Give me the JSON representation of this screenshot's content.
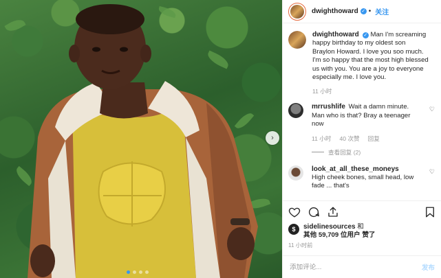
{
  "post": {
    "author": "dwighthoward",
    "follow_label": "关注",
    "more_label": "•••",
    "caption": "Man I'm screaming happy birthday to my oldest son Braylon Howard. I love you soo much. I'm so happy that the most high blessed us with you. You are a joy to everyone especially me. I love you.",
    "caption_time": "11 小时"
  },
  "comments": [
    {
      "user": "mrrushlife",
      "text": "Wait a damn minute. Man who is that? Bray a teenager now",
      "time": "11 小时",
      "likes": "40 次赞",
      "reply_label": "回复",
      "view_replies": "查看回复 (2)"
    },
    {
      "user": "look_at_all_these_moneys",
      "text": "High cheek bones, small head, low fade ... that's"
    }
  ],
  "likes": {
    "user": "sidelinesources",
    "and_label": "和",
    "others_prefix": "其他",
    "count": "59,709",
    "others_suffix": "位用户 赞了"
  },
  "time_ago": "11 小时前",
  "add_comment": {
    "placeholder": "添加评论...",
    "post_label": "发布"
  },
  "icons": {
    "verified": "✓",
    "heart": "♡",
    "carousel_next": "›"
  },
  "carousel": {
    "slides": 4,
    "active": 0
  },
  "colors": {
    "accent": "#3897f0",
    "muted": "#999999",
    "text": "#262626"
  }
}
